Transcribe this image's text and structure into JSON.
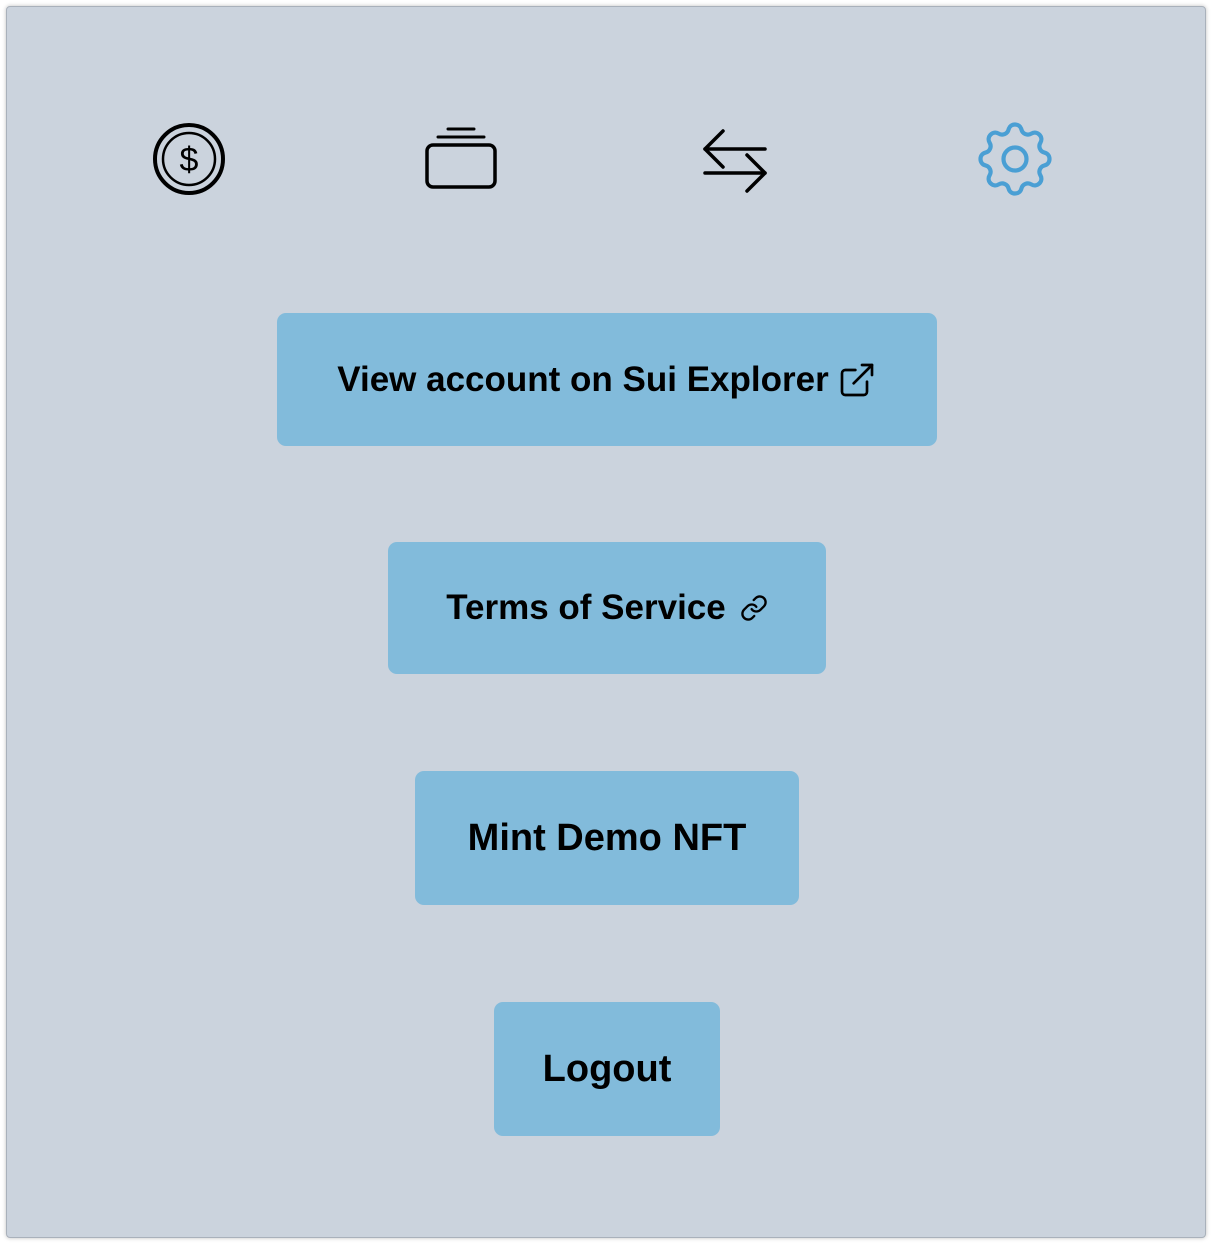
{
  "nav": {
    "items": [
      {
        "icon": "dollar-coin-icon",
        "active": false
      },
      {
        "icon": "stacked-cards-icon",
        "active": false
      },
      {
        "icon": "swap-arrows-icon",
        "active": false
      },
      {
        "icon": "gear-icon",
        "active": true
      }
    ],
    "active_color": "#4a9fd4",
    "inactive_color": "#000000"
  },
  "actions": {
    "explorer_label": "View account on Sui Explorer",
    "terms_label": "Terms of Service",
    "mint_label": "Mint Demo NFT",
    "logout_label": "Logout"
  },
  "colors": {
    "background": "#cbd3dd",
    "button": "#82bbdb",
    "text": "#000000"
  }
}
